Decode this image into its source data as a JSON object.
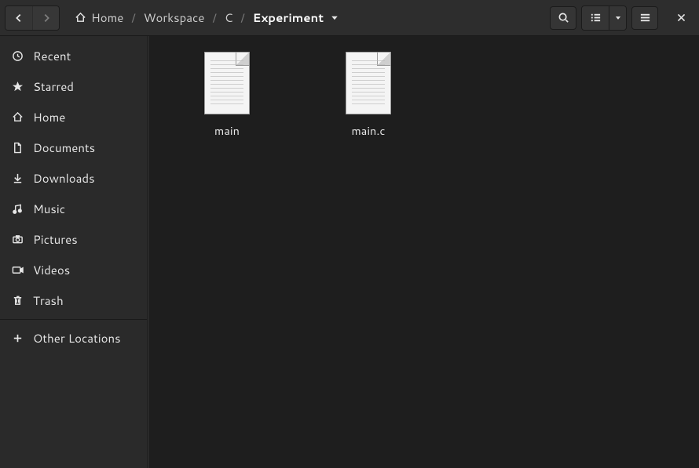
{
  "nav": {
    "back_enabled": true,
    "forward_enabled": false
  },
  "breadcrumbs": [
    {
      "label": "Home",
      "icon": "home",
      "current": false
    },
    {
      "label": "Workspace",
      "icon": null,
      "current": false
    },
    {
      "label": "C",
      "icon": null,
      "current": false
    },
    {
      "label": "Experiment",
      "icon": null,
      "current": true
    }
  ],
  "toolbar": {
    "search": "search",
    "view_list": "list-view",
    "view_dropdown": "view-options",
    "hamburger": "main-menu",
    "close": "close"
  },
  "sidebar": {
    "items": [
      {
        "label": "Recent",
        "icon": "recent"
      },
      {
        "label": "Starred",
        "icon": "star"
      },
      {
        "label": "Home",
        "icon": "home"
      },
      {
        "label": "Documents",
        "icon": "document"
      },
      {
        "label": "Downloads",
        "icon": "download"
      },
      {
        "label": "Music",
        "icon": "music"
      },
      {
        "label": "Pictures",
        "icon": "pictures"
      },
      {
        "label": "Videos",
        "icon": "videos"
      },
      {
        "label": "Trash",
        "icon": "trash"
      }
    ],
    "other_locations": {
      "label": "Other Locations",
      "icon": "plus"
    }
  },
  "files": [
    {
      "name": "main",
      "kind": "text"
    },
    {
      "name": "main.c",
      "kind": "text"
    }
  ]
}
